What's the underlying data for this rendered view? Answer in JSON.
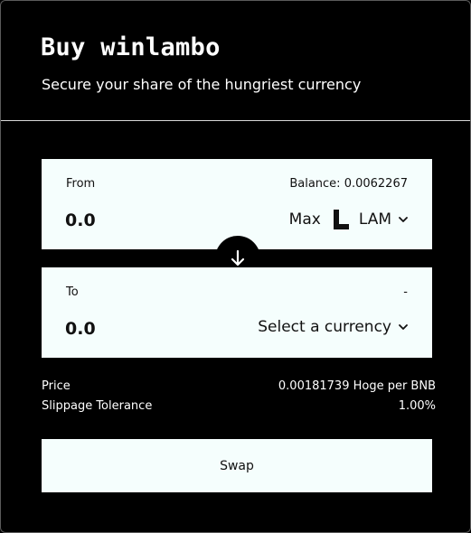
{
  "header": {
    "title": "Buy winlambo",
    "subtitle": "Secure your share of the hungriest currency"
  },
  "from_panel": {
    "label": "From",
    "balance": "Balance: 0.0062267",
    "amount": "0.0",
    "max_label": "Max",
    "token_symbol": "LAM",
    "token_icon": "lambo-logo-icon"
  },
  "switch": {
    "icon": "arrow-down-icon"
  },
  "to_panel": {
    "label": "To",
    "balance": "-",
    "amount": "0.0",
    "select_label": "Select a currency"
  },
  "info": {
    "price_label": "Price",
    "price_value": "0.00181739 Hoge per BNB",
    "slippage_label": "Slippage Tolerance",
    "slippage_value": "1.00%"
  },
  "swap_label": "Swap",
  "colors": {
    "background": "#000000",
    "panel": "#f5fefd",
    "text_dark": "#111111",
    "text_light": "#ffffff"
  }
}
